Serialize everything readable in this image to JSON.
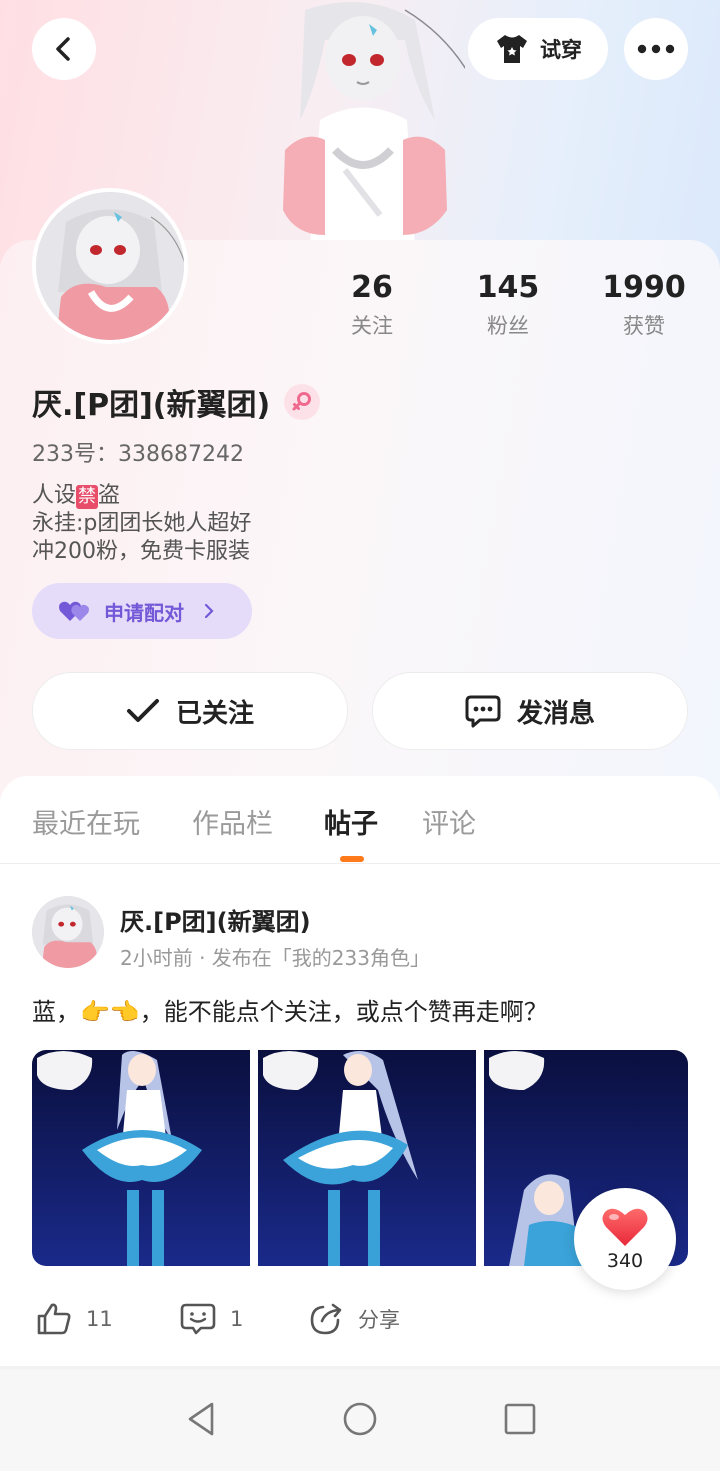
{
  "header": {
    "tryon_label": "试穿"
  },
  "profile": {
    "nickname": "厌.[P团](新翼团)",
    "uid_label": "233号：",
    "uid_value": "338687242",
    "bio": {
      "line1_prefix": "人设",
      "line1_badge": "禁",
      "line1_suffix": "盗",
      "line2": "永挂:p团团长她人超好",
      "line3": "冲200粉，免费卡服装"
    },
    "pair_label": "申请配对",
    "stats": [
      {
        "num": "26",
        "label": "关注"
      },
      {
        "num": "145",
        "label": "粉丝"
      },
      {
        "num": "1990",
        "label": "获赞"
      }
    ],
    "follow_label": "已关注",
    "message_label": "发消息"
  },
  "tabs": [
    {
      "label": "最近在玩",
      "active": false
    },
    {
      "label": "作品栏",
      "active": false
    },
    {
      "label": "帖子",
      "active": true
    },
    {
      "label": "评论",
      "active": false
    }
  ],
  "post": {
    "author": "厌.[P团](新翼团)",
    "meta": "2小时前 · 发布在「我的233角色」",
    "text": "蓝，👉👈，能不能点个关注，或点个赞再走啊？",
    "like_count": "11",
    "comment_count": "1",
    "share_label": "分享",
    "float_like_count": "340"
  },
  "colors": {
    "accent_orange": "#ff7a1a",
    "pair_purple": "#7359d8",
    "heart_red": "#f0404a",
    "gender_pink": "#f06a8f"
  }
}
